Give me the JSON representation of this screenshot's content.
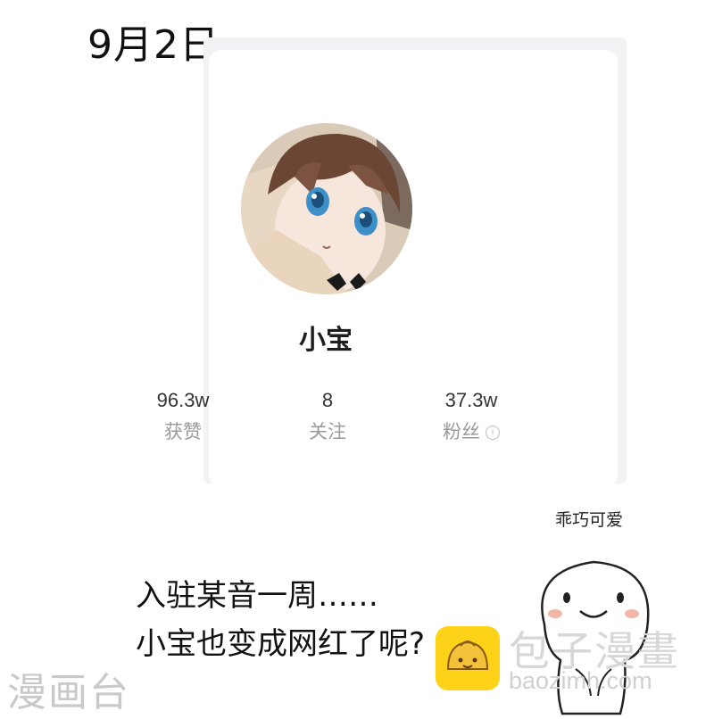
{
  "date": "9月2日",
  "profile": {
    "username": "小宝",
    "stats": [
      {
        "value": "96.3w",
        "label": "获赞"
      },
      {
        "value": "8",
        "label": "关注"
      },
      {
        "value": "37.3w",
        "label": "粉丝"
      }
    ],
    "info_icon": "info-icon"
  },
  "caption": {
    "line1": "入驻某音一周……",
    "line2": "小宝也变成网红了呢?"
  },
  "sticker": {
    "text": "乖巧可爱"
  },
  "watermarks": {
    "left": "漫画台",
    "brand_name": "包子漫畫",
    "brand_url": "baozimh.com"
  }
}
